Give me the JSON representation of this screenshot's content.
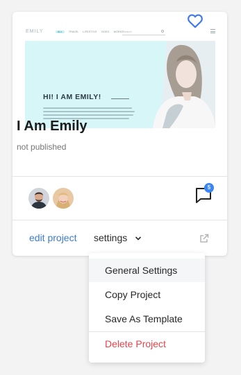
{
  "project": {
    "title": "I Am Emily",
    "status": "not published",
    "comment_count": "5",
    "actions": {
      "edit_label": "edit project",
      "settings_label": "settings"
    },
    "preview": {
      "logo": "EMILY",
      "menu": [
        "ALL",
        "TRAVEL",
        "LIFESTYLE",
        "VIDEO",
        "WORKS"
      ],
      "search_placeholder": "Search",
      "heading": "HI! I AM EMILY!"
    }
  },
  "dropdown": {
    "items": [
      "General Settings",
      "Copy Project",
      "Save As Template"
    ],
    "danger_item": "Delete Project"
  },
  "colors": {
    "accent": "#3b7bd6",
    "badge": "#3b86f7",
    "danger": "#e8434a",
    "preview_bg": "#d7f6f8"
  },
  "icons": [
    "heart-icon",
    "comment-icon",
    "chevron-down-icon",
    "external-link-icon"
  ]
}
